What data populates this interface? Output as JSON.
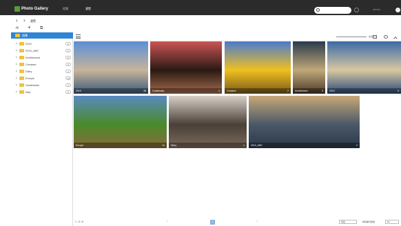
{
  "app": {
    "title": "Photo Gallery"
  },
  "header": {
    "tabs": [
      {
        "label": "相簿"
      },
      {
        "label": "瀏覽"
      }
    ],
    "search": {
      "placeholder": ""
    },
    "user": "admin"
  },
  "breadcrumb": {
    "current": "瀏覽"
  },
  "sidebar": {
    "root": "相簿",
    "items": [
      {
        "label": "2010",
        "count": "6"
      },
      {
        "label": "2010_ABC",
        "count": "2"
      },
      {
        "label": "Architecture",
        "count": "3"
      },
      {
        "label": "Creature",
        "count": "2"
      },
      {
        "label": "Diary",
        "count": "1"
      },
      {
        "label": "Europe",
        "count": "14"
      },
      {
        "label": "Guatemala",
        "count": "4"
      },
      {
        "label": "Italy",
        "count": "3"
      }
    ]
  },
  "toolbar": {
    "zoom_label": "縮放大小"
  },
  "gallery": {
    "tiles": [
      {
        "name": "2010",
        "meta": "48",
        "colors": [
          "#5b8fd6",
          "#c7b49a",
          "#3a5a7a"
        ]
      },
      {
        "name": "Guatemala",
        "meta": "4",
        "colors": [
          "#c55",
          "#2a1a14",
          "#a36a4a"
        ]
      },
      {
        "name": "Creature",
        "meta": "2",
        "colors": [
          "#4a7ad0",
          "#f0c020",
          "#7a5a1a"
        ]
      },
      {
        "name": "Architecture",
        "meta": "3",
        "colors": [
          "#2a3a4a",
          "#c0a878",
          "#4a3a2a"
        ]
      },
      {
        "name": "2010",
        "meta": "6",
        "colors": [
          "#3a6aa8",
          "#d8c8a0",
          "#2a4a7a"
        ]
      },
      {
        "name": "Europe",
        "meta": "14",
        "colors": [
          "#5a8ac0",
          "#4a8a2a",
          "#8a6a3a"
        ]
      },
      {
        "name": "Diary",
        "meta": "1",
        "colors": [
          "#d8d0c8",
          "#4a4038",
          "#7a6a5a"
        ]
      },
      {
        "name": "2010_ABC",
        "meta": "2",
        "colors": [
          "#c8a878",
          "#4a5868",
          "#2a3848"
        ]
      }
    ]
  },
  "footer": {
    "pager_text": "1 - 8 / 8",
    "prev": "‹",
    "next": "›",
    "page": "1",
    "view_select": "列表",
    "per_page_label": "每頁顯示數量",
    "per_page_value": "50"
  }
}
